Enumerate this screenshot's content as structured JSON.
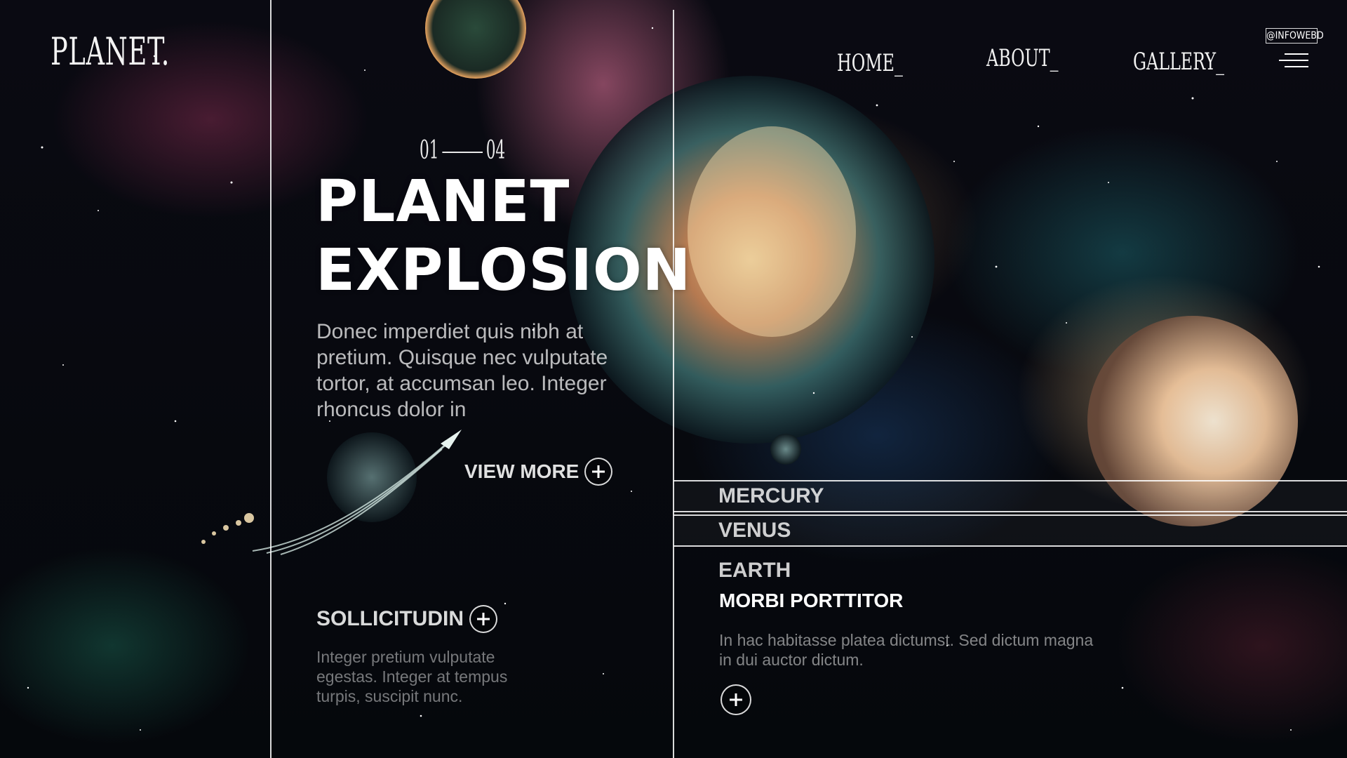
{
  "brand": {
    "logo": "PLANET."
  },
  "nav": {
    "items": [
      {
        "label": "HOME_"
      },
      {
        "label": "ABOUT_"
      },
      {
        "label": "GALLERY_"
      }
    ],
    "handle": "@INFOWEBD",
    "menu_icon": "hamburger-menu-icon"
  },
  "hero": {
    "counter_current": "01",
    "counter_total": "04",
    "title_line1": "PLANET",
    "title_line2": "EXPLOSION",
    "description": "Donec imperdiet quis nibh at pretium. Quisque nec vulputate tortor, at accumsan leo. Integer rhoncus dolor in",
    "cta_label": "VIEW MORE",
    "cta_icon": "plus-circle-icon"
  },
  "secondary": {
    "title": "SOLLICITUDIN",
    "description": "Integer pretium vulputate egestas. Integer at tempus turpis, suscipit nunc."
  },
  "planets": {
    "items": [
      {
        "label": "MERCURY"
      },
      {
        "label": "VENUS"
      },
      {
        "label": "EARTH"
      }
    ],
    "active": {
      "subtitle": "MORBI PORTTITOR",
      "description": "In hac habitasse platea dictumst. Sed dictum magna in dui auctor dictum."
    }
  },
  "colors": {
    "background": "#05070a",
    "text": "#ffffff",
    "accent_pink": "#eb78a0",
    "accent_teal": "#2896a0"
  }
}
